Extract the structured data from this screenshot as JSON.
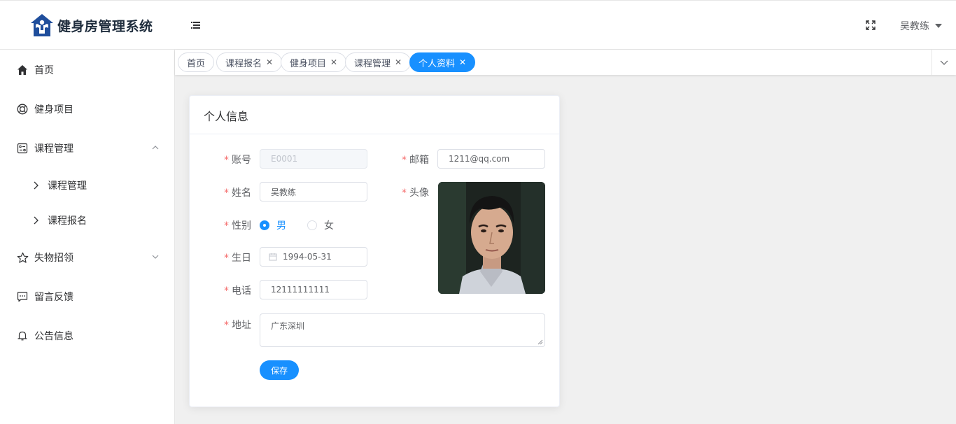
{
  "header": {
    "app_title": "健身房管理系统",
    "user_name": "吴教练"
  },
  "sidebar": {
    "items": [
      {
        "label": "首页",
        "icon": "home-icon"
      },
      {
        "label": "健身项目",
        "icon": "target-icon"
      },
      {
        "label": "课程管理",
        "icon": "course-icon",
        "expanded": true,
        "children": [
          "课程管理",
          "课程报名"
        ]
      },
      {
        "label": "失物招领",
        "icon": "star-icon",
        "expanded": false
      },
      {
        "label": "留言反馈",
        "icon": "message-icon"
      },
      {
        "label": "公告信息",
        "icon": "bell-icon"
      }
    ]
  },
  "tabs": [
    {
      "label": "首页",
      "closable": false
    },
    {
      "label": "课程报名",
      "closable": true
    },
    {
      "label": "健身项目",
      "closable": true
    },
    {
      "label": "课程管理",
      "closable": true
    },
    {
      "label": "个人资料",
      "closable": true,
      "active": true
    }
  ],
  "profile": {
    "title": "个人信息",
    "required_mark": "*",
    "labels": {
      "account": "账号",
      "email": "邮箱",
      "name": "姓名",
      "avatar": "头像",
      "gender": "性别",
      "birthday": "生日",
      "phone": "电话",
      "address": "地址"
    },
    "values": {
      "account": "E0001",
      "email": "1211@qq.com",
      "name": "吴教练",
      "birthday": "1994-05-31",
      "phone": "12111111111",
      "address": "广东深圳"
    },
    "gender_options": [
      "男",
      "女"
    ],
    "gender_selected": "男",
    "save_label": "保存"
  },
  "colors": {
    "primary": "#1890ff",
    "required": "#f56c6c",
    "logo": "#1f4e9c"
  }
}
